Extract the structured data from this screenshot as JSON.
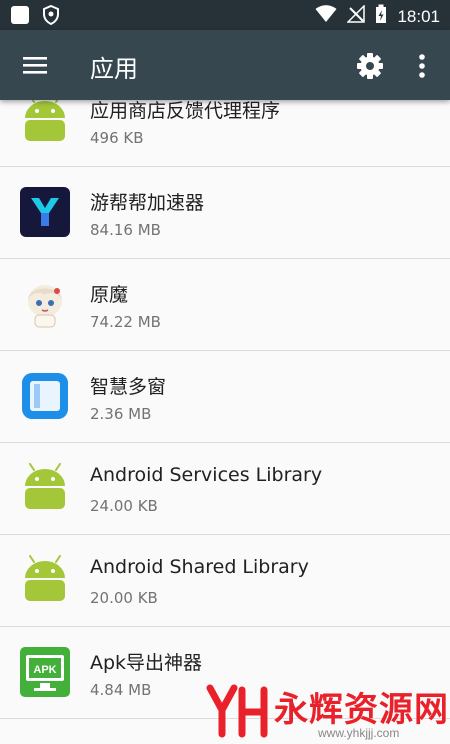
{
  "status_bar": {
    "time": "18:01"
  },
  "app_bar": {
    "title": "应用"
  },
  "apps": [
    {
      "name": "应用商店反馈代理程序",
      "size": "496 KB",
      "icon": "android-robot-icon"
    },
    {
      "name": "游帮帮加速器",
      "size": "84.16 MB",
      "icon": "youbangbang-accelerator-icon"
    },
    {
      "name": "原魔",
      "size": "74.22 MB",
      "icon": "paimon-avatar-icon"
    },
    {
      "name": "智慧多窗",
      "size": "2.36 MB",
      "icon": "smart-multiwindow-icon"
    },
    {
      "name": "Android Services Library",
      "size": "24.00 KB",
      "icon": "android-robot-icon"
    },
    {
      "name": "Android Shared Library",
      "size": "20.00 KB",
      "icon": "android-robot-icon"
    },
    {
      "name": "Apk导出神器",
      "size": "4.84 MB",
      "icon": "apk-exporter-icon"
    }
  ],
  "watermark": {
    "title": "永辉资源网",
    "url": "www.yhkjjj.com"
  },
  "colors": {
    "status_bar": "#263238",
    "app_bar": "#37474f",
    "android_green": "#a4c639",
    "watermark_red": "#e8212b"
  }
}
